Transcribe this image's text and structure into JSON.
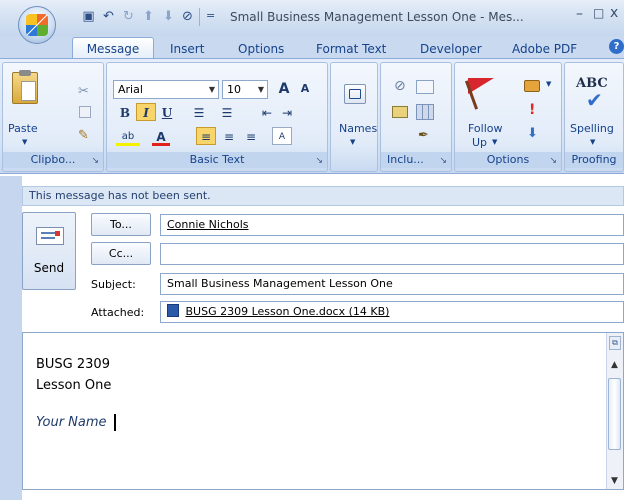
{
  "window": {
    "title": "Small Business Management Lesson One - Mes...",
    "min_glyph": "–",
    "max_glyph": "□",
    "close_glyph": "x"
  },
  "quick_access": {
    "save": "▣",
    "undo": "↶",
    "redo": "↻",
    "prev": "⬆",
    "next": "⬇",
    "attach": "⊘",
    "more": "="
  },
  "tabs": [
    "Message",
    "Insert",
    "Options",
    "Format Text",
    "Developer",
    "Adobe PDF"
  ],
  "ribbon": {
    "clipboard": {
      "label": "Clipboard",
      "label_short": "Clipbo...",
      "paste": "Paste"
    },
    "basic_text": {
      "label": "Basic Text",
      "font_name": "Arial",
      "font_size": "10"
    },
    "names": {
      "label": "Names",
      "names_button": "Names"
    },
    "include": {
      "label": "Inclu..."
    },
    "options": {
      "label": "Options",
      "follow_up_line1": "Follow",
      "follow_up_line2": "Up"
    },
    "proofing": {
      "label": "Proofing",
      "spelling": "Spelling",
      "abc": "ABC"
    }
  },
  "message": {
    "notice": "This message has not been sent.",
    "send_label": "Send",
    "to_button": "To...",
    "cc_button": "Cc...",
    "subject_label": "Subject:",
    "attached_label": "Attached:",
    "to_value": "Connie Nichols",
    "cc_value": "",
    "subject_value": "Small Business Management Lesson One",
    "attachment": "BUSG 2309 Lesson One.docx (14 KB)"
  },
  "body": {
    "line1": "BUSG 2309",
    "line2": "Lesson One",
    "signature": "Your Name"
  },
  "colors": {
    "ribbon_text": "#15428b",
    "accent": "#2f6fc9",
    "follow_up_flag": "#d7262e"
  }
}
